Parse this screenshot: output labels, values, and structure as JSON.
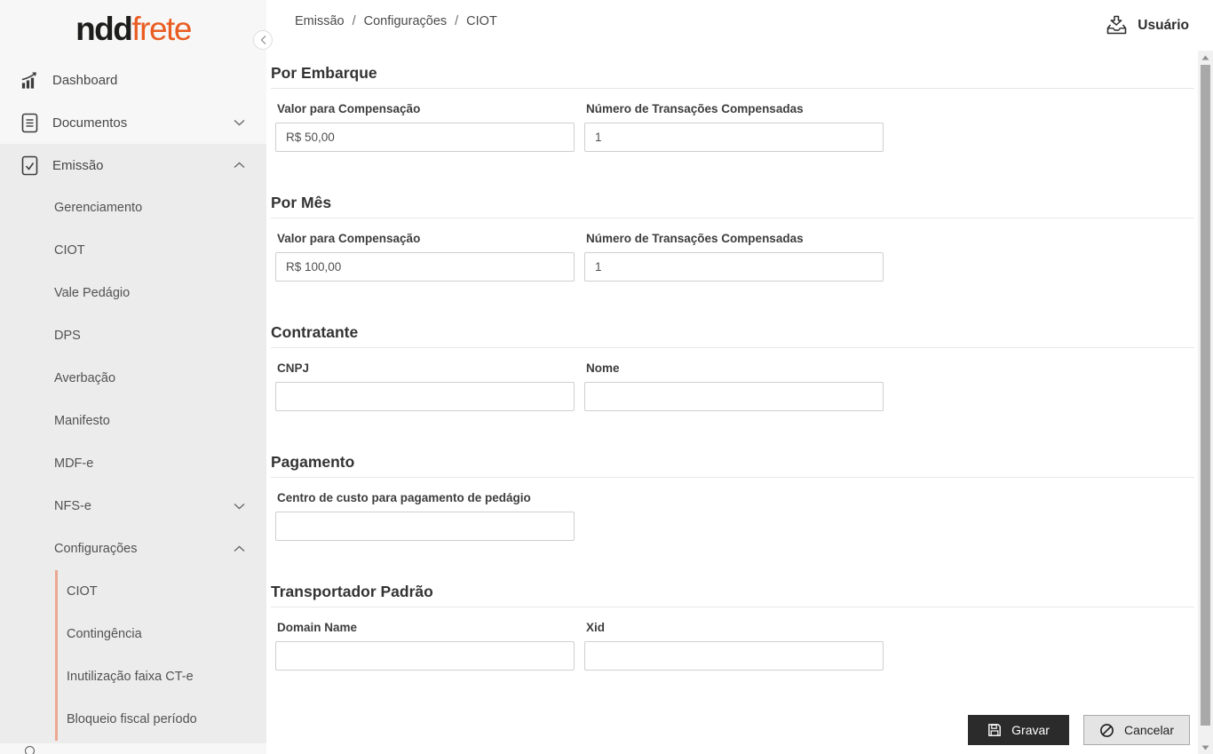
{
  "brand": {
    "name_left": "ndd",
    "name_right": "frete"
  },
  "header": {
    "breadcrumb": [
      "Emissão",
      "Configurações",
      "CIOT"
    ],
    "separator": "/",
    "user_label": "Usuário"
  },
  "sidebar": {
    "items": [
      {
        "label": "Dashboard",
        "icon": "bar-chart-icon"
      },
      {
        "label": "Documentos",
        "icon": "document-icon"
      },
      {
        "label": "Emissão",
        "icon": "document-check-icon"
      }
    ],
    "emissao_submenu": [
      {
        "label": "Gerenciamento"
      },
      {
        "label": "CIOT"
      },
      {
        "label": "Vale Pedágio"
      },
      {
        "label": "DPS"
      },
      {
        "label": "Averbação"
      },
      {
        "label": "Manifesto"
      },
      {
        "label": "MDF-e"
      },
      {
        "label": "NFS-e"
      },
      {
        "label": "Configurações"
      }
    ],
    "configuracoes_submenu": [
      {
        "label": "CIOT"
      },
      {
        "label": "Contingência"
      },
      {
        "label": "Inutilização faixa CT-e"
      },
      {
        "label": "Bloqueio fiscal período"
      }
    ]
  },
  "form": {
    "sections": [
      {
        "title": "Por Embarque",
        "fields": [
          {
            "label": "Valor para Compensação",
            "value": "R$ 50,00"
          },
          {
            "label": "Número de Transações Compensadas",
            "value": "1"
          }
        ]
      },
      {
        "title": "Por Mês",
        "fields": [
          {
            "label": "Valor para Compensação",
            "value": "R$ 100,00"
          },
          {
            "label": "Número de Transações Compensadas",
            "value": "1"
          }
        ]
      },
      {
        "title": "Contratante",
        "fields": [
          {
            "label": "CNPJ",
            "value": ""
          },
          {
            "label": "Nome",
            "value": ""
          }
        ]
      },
      {
        "title": "Pagamento",
        "fields": [
          {
            "label": "Centro de custo para pagamento de pedágio",
            "value": ""
          }
        ]
      },
      {
        "title": "Transportador Padrão",
        "fields": [
          {
            "label": "Domain Name",
            "value": ""
          },
          {
            "label": "Xid",
            "value": ""
          }
        ]
      }
    ],
    "actions": {
      "save": "Gravar",
      "cancel": "Cancelar"
    }
  },
  "colors": {
    "accent": "#e95d22",
    "submenu_indicator": "#eba78f",
    "save_button_bg": "#2b2b2b"
  }
}
